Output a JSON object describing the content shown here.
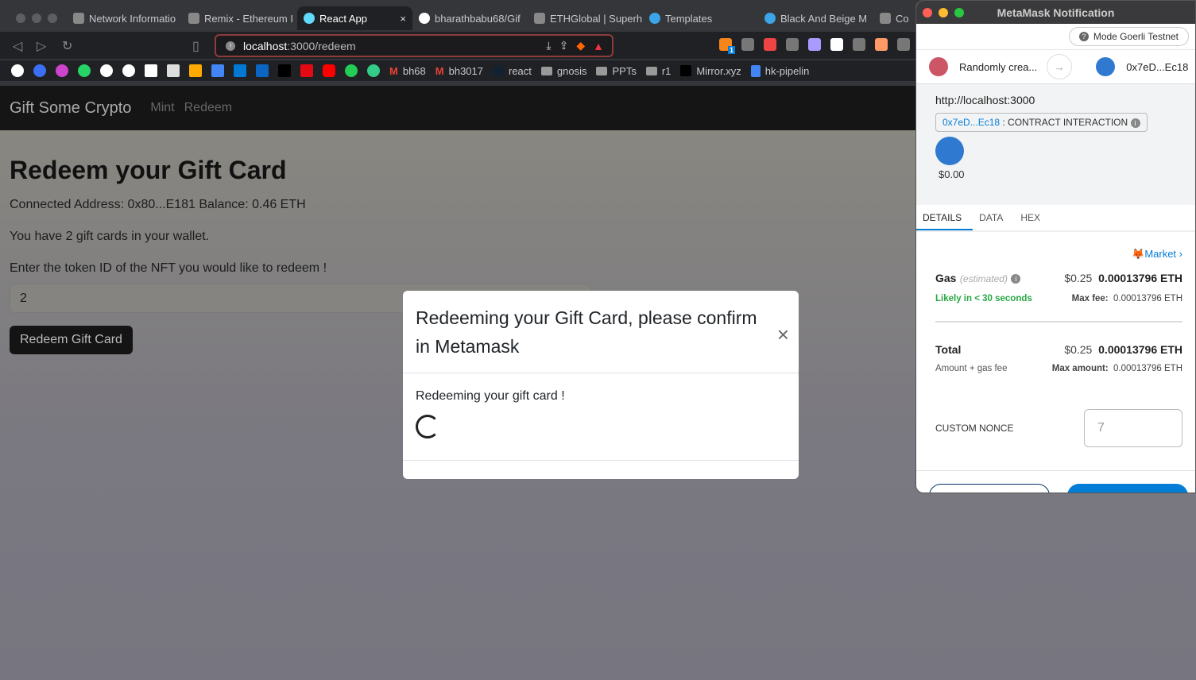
{
  "browser": {
    "tabs": [
      {
        "label": "Network Informatio"
      },
      {
        "label": "Remix - Ethereum I"
      },
      {
        "label": "React App",
        "active": true
      },
      {
        "label": "bharathbabu68/Gif"
      },
      {
        "label": "ETHGlobal | Superh"
      },
      {
        "label": "Templates"
      },
      {
        "label": "Black And Beige M"
      },
      {
        "label": "Co"
      }
    ],
    "close_glyph": "×",
    "url_host": "localhost",
    "url_path": ":3000/redeem",
    "bookmarks": [
      {
        "label": "bh68",
        "icon": "gmail-icon"
      },
      {
        "label": "bh3017",
        "icon": "gmail-icon"
      },
      {
        "label": "react",
        "icon": "react-icon"
      },
      {
        "label": "gnosis",
        "icon": "folder-icon"
      },
      {
        "label": "PPTs",
        "icon": "folder-icon"
      },
      {
        "label": "r1",
        "icon": "folder-icon"
      },
      {
        "label": "Mirror.xyz",
        "icon": "mirror-icon"
      },
      {
        "label": "hk-pipelin",
        "icon": "docs-icon"
      }
    ],
    "extension_badge": "1"
  },
  "app": {
    "brand": "Gift Some Crypto",
    "nav": [
      "Mint",
      "Redeem"
    ],
    "title": "Redeem your Gift Card",
    "connected": "Connected Address: 0x80...E181 Balance: 0.46 ETH",
    "count_text": "You have 2 gift cards in your wallet.",
    "prompt": "Enter the token ID of the NFT you would like to redeem !",
    "token_value": "2",
    "redeem_button": "Redeem Gift Card"
  },
  "modal": {
    "title": "Redeeming your Gift Card, please confirm in Metamask",
    "body": "Redeeming your gift card !",
    "close_glyph": "×"
  },
  "metamask": {
    "window_title": "MetaMask Notification",
    "network": "Mode Goerli Testnet",
    "from": "Randomly crea...",
    "to": "0x7eD...Ec18",
    "origin": "http://localhost:3000",
    "contract_addr": "0x7eD...Ec18",
    "contract_label": " : CONTRACT INTERACTION",
    "token_usd": "$0.00",
    "tabs": [
      "DETAILS",
      "DATA",
      "HEX"
    ],
    "market": "Market",
    "gas_label": "Gas",
    "gas_est": "(estimated)",
    "gas_usd": "$0.25",
    "gas_eth": "0.00013796 ETH",
    "likely": "Likely in < 30 seconds",
    "max_fee_label": "Max fee:",
    "max_fee": "0.00013796 ETH",
    "total_label": "Total",
    "total_usd": "$0.25",
    "total_eth": "0.00013796 ETH",
    "amount_gas": "Amount + gas fee",
    "max_amount_label": "Max amount:",
    "max_amount": "0.00013796 ETH",
    "nonce_label": "CUSTOM NONCE",
    "nonce_placeholder": "7",
    "colors": {
      "accent": "#037dd6",
      "success": "#28a745"
    }
  }
}
